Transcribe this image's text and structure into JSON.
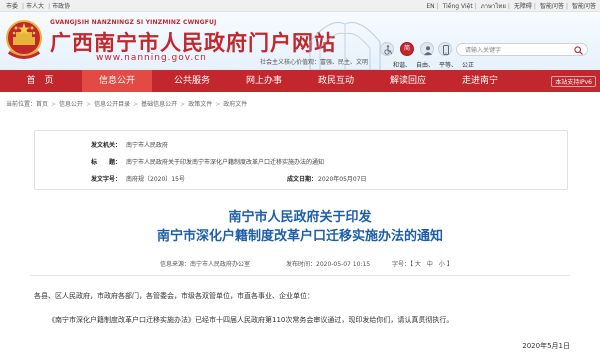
{
  "topbar": {
    "links": [
      "市委",
      "市人大",
      "市政协"
    ],
    "langs": [
      "EN",
      "Tiếng Việt",
      "ภาษาไทย",
      "无障碍",
      "智能问答",
      "智能问答"
    ]
  },
  "header": {
    "pinyin": "GVANGJSIH NANZNINGZ SI YINZMINZ CWNGFUJ",
    "site_name": "广西南宁市人民政府门户网站",
    "domain": "www.nanning.gov.cn",
    "values_text": "社会主义核心价值观：富强、民主、文明",
    "elder_label": "简",
    "search_placeholder": "请输入关键字",
    "hotwords": [
      "和谐、",
      "自由、",
      "平等、",
      "公正"
    ]
  },
  "nav": {
    "items": [
      "首　页",
      "信息公开",
      "公共服务",
      "网上办事",
      "政民互动",
      "解读回应",
      "走进南宁"
    ],
    "active_index": 1,
    "ipv6": "本站支持IPv6"
  },
  "breadcrumb": [
    "当前位置：首页",
    "信息公开",
    "信息公开目录",
    "基础信息公开",
    "政策文件",
    "政府文件"
  ],
  "meta": {
    "issuer_label": "发文机关：",
    "issuer": "南宁市人民政府",
    "title_label": "标　　题：",
    "title": "南宁市人民政府关于印发南宁市深化户籍制度改革户口迁移实施办法的通知",
    "docno_label": "发文字号：",
    "docno": "南府规〔2020〕15号",
    "date_label": "成文日期：",
    "date": "2020年05月07日"
  },
  "document": {
    "title_line1": "南宁市人民政府关于印发",
    "title_line2": "南宁市深化户籍制度改革户口迁移实施办法的通知",
    "source": "信息来源：南宁市人民政府办公室",
    "published": "发布时间：2020-05-07 10:15",
    "font_size": "字号：【 大　中　小 】",
    "salutation": "各县、区人民政府，市政府各部门，各管委会，市级各双管单位，市直各事业、企业单位：",
    "body": "《南宁市深化户籍制度改革户口迁移实施办法》已经市十四届人民政府第110次常务会审议通过，现印发给你们，请认真贯彻执行。",
    "sign_date": "2020年5月1日"
  },
  "colors": {
    "brand_red": "#c1272d",
    "nav_active": "#e44a44",
    "title_blue": "#1d5ea8"
  }
}
